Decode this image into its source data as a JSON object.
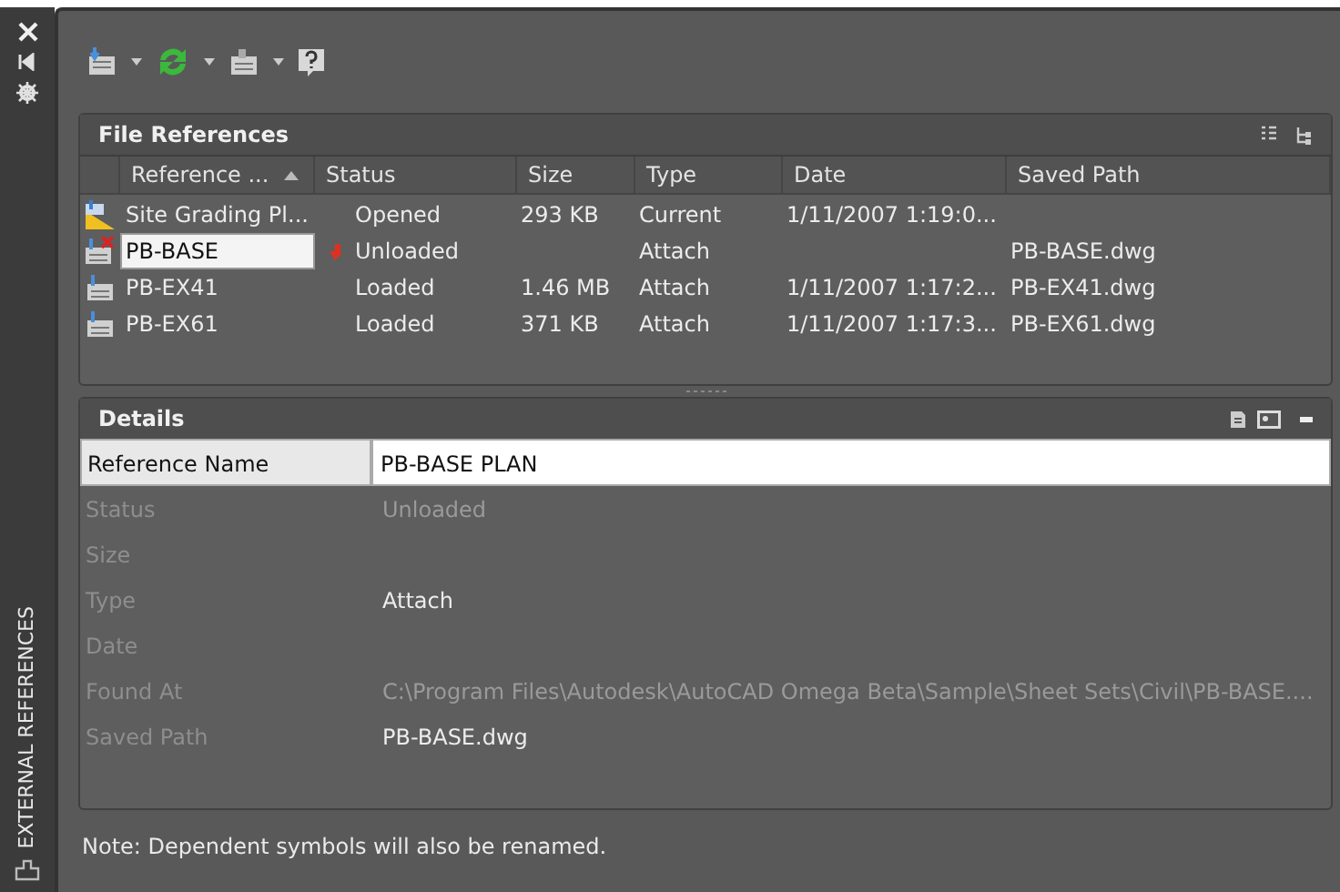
{
  "palette_title": "EXTERNAL REFERENCES",
  "file_references": {
    "title": "File References",
    "columns": [
      {
        "label": "Reference ...",
        "sorted": true
      },
      {
        "label": "Status",
        "sorted": false
      },
      {
        "label": "Size",
        "sorted": false
      },
      {
        "label": "Type",
        "sorted": false
      },
      {
        "label": "Date",
        "sorted": false
      },
      {
        "label": "Saved Path",
        "sorted": false
      }
    ],
    "rows": [
      {
        "kind": "drawing",
        "name": "Site Grading Pl...",
        "editing": false,
        "warning": false,
        "status": "Opened",
        "size": "293 KB",
        "type": "Current",
        "date": "1/11/2007 1:19:0..."
      },
      {
        "kind": "xref_unloaded",
        "name": "PB-BASE",
        "editing": true,
        "warning": true,
        "status": "Unloaded",
        "type": "Attach",
        "saved_path": "PB-BASE.dwg"
      },
      {
        "kind": "xref",
        "name": "PB-EX41",
        "editing": false,
        "warning": false,
        "status": "Loaded",
        "size": "1.46 MB",
        "type": "Attach",
        "date": "1/11/2007 1:17:2...",
        "saved_path": "PB-EX41.dwg"
      },
      {
        "kind": "xref",
        "name": "PB-EX61",
        "editing": false,
        "warning": false,
        "status": "Loaded",
        "size": "371 KB",
        "type": "Attach",
        "date": "1/11/2007 1:17:3...",
        "saved_path": "PB-EX61.dwg"
      }
    ]
  },
  "details": {
    "title": "Details",
    "rows": [
      {
        "kind": "editable",
        "label": "Reference Name",
        "value": "PB-BASE PLAN"
      },
      {
        "kind": "text",
        "label": "Status",
        "value": "Unloaded",
        "dim": true
      },
      {
        "kind": "text",
        "label": "Size"
      },
      {
        "kind": "text",
        "label": "Type",
        "value": "Attach",
        "dim": false
      },
      {
        "kind": "text",
        "label": "Date"
      },
      {
        "kind": "text",
        "label": "Found At",
        "value": "C:\\Program Files\\Autodesk\\AutoCAD Omega Beta\\Sample\\Sheet Sets\\Civil\\PB-BASE....",
        "dim": true
      },
      {
        "kind": "text",
        "label": "Saved Path",
        "value": "PB-BASE.dwg",
        "dim": false
      }
    ]
  },
  "note": "Note: Dependent symbols will also be renamed."
}
